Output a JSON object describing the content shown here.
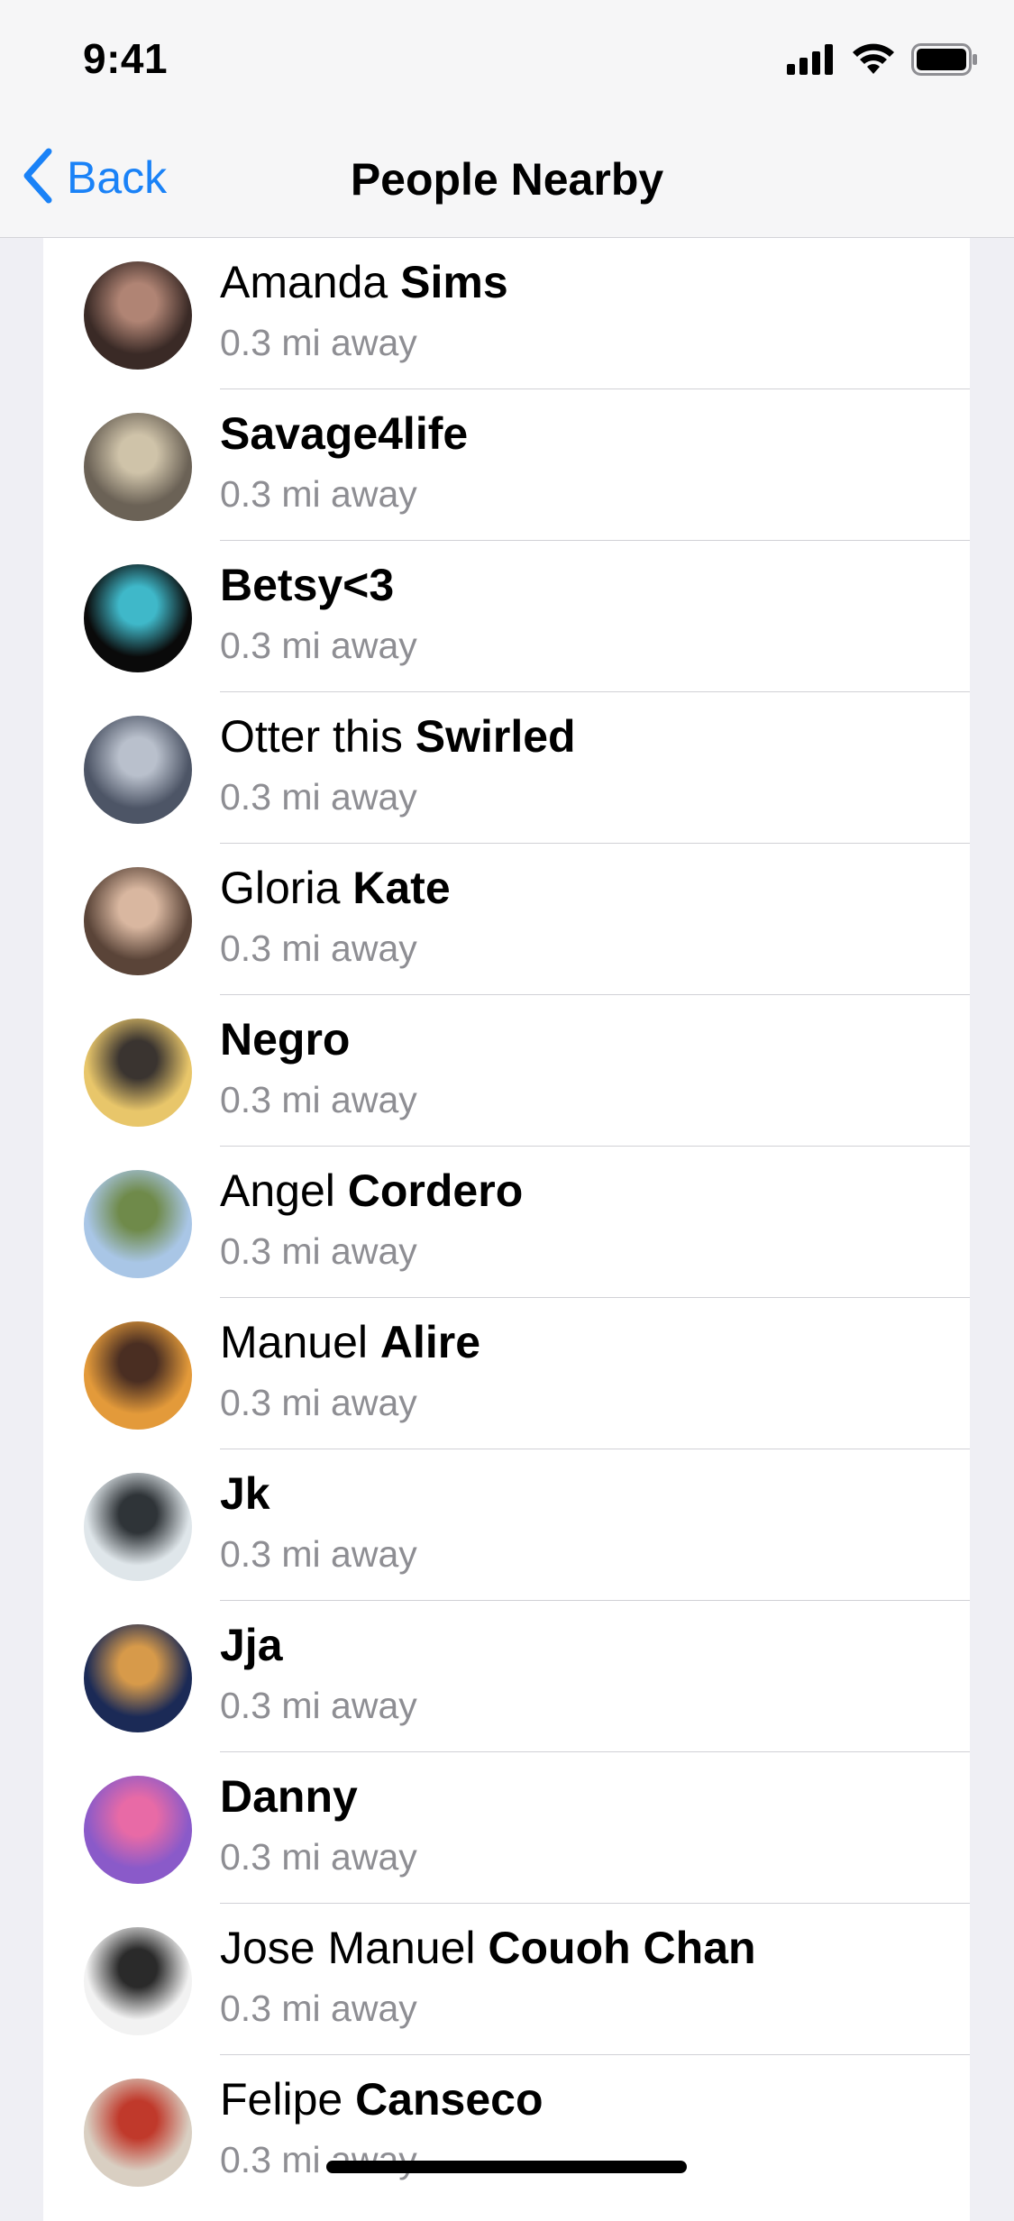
{
  "status": {
    "time": "9:41",
    "icons": [
      "cellular-signal-icon",
      "wifi-icon",
      "battery-icon"
    ]
  },
  "nav": {
    "back_label": "Back",
    "title": "People Nearby",
    "accent_color": "#1a82f7"
  },
  "people": [
    {
      "first": "Amanda ",
      "last": "Sims",
      "distance": "0.3 mi away",
      "avatar_colors": [
        "#3a2a26",
        "#b08474"
      ]
    },
    {
      "first": "",
      "last": "Savage4life",
      "distance": "0.3 mi away",
      "avatar_colors": [
        "#6b6256",
        "#cfc3a9"
      ]
    },
    {
      "first": "",
      "last": "Betsy<3",
      "distance": "0.3 mi away",
      "avatar_colors": [
        "#0a0a0a",
        "#3fb8c9"
      ]
    },
    {
      "first": "Otter this ",
      "last": "Swirled",
      "distance": "0.3 mi away",
      "avatar_colors": [
        "#4d5566",
        "#b9c0cc"
      ]
    },
    {
      "first": "Gloria ",
      "last": "Kate",
      "distance": "0.3 mi away",
      "avatar_colors": [
        "#5a4438",
        "#d9b7a0"
      ]
    },
    {
      "first": "",
      "last": "Negro",
      "distance": "0.3 mi away",
      "avatar_colors": [
        "#e8c66a",
        "#3a3430"
      ]
    },
    {
      "first": "Angel ",
      "last": "Cordero",
      "distance": "0.3 mi away",
      "avatar_colors": [
        "#a9c6e6",
        "#6f8a4a"
      ]
    },
    {
      "first": "Manuel ",
      "last": "Alire",
      "distance": "0.3 mi away",
      "avatar_colors": [
        "#e39a3a",
        "#4a2e22"
      ]
    },
    {
      "first": "",
      "last": "Jk",
      "distance": "0.3 mi away",
      "avatar_colors": [
        "#dfe6ea",
        "#2f3438"
      ]
    },
    {
      "first": "",
      "last": "Jja",
      "distance": "0.3 mi away",
      "avatar_colors": [
        "#1b2a56",
        "#d79a4a"
      ]
    },
    {
      "first": "",
      "last": "Danny",
      "distance": "0.3 mi away",
      "avatar_colors": [
        "#8a5ac9",
        "#e86aa6"
      ]
    },
    {
      "first": "Jose Manuel ",
      "last": "Couoh Chan",
      "distance": "0.3 mi away",
      "avatar_colors": [
        "#f2f2f2",
        "#2a2a2a"
      ]
    },
    {
      "first": "Felipe ",
      "last": "Canseco",
      "distance": "0.3 mi away",
      "avatar_colors": [
        "#d9cfc2",
        "#c0392b"
      ]
    }
  ]
}
